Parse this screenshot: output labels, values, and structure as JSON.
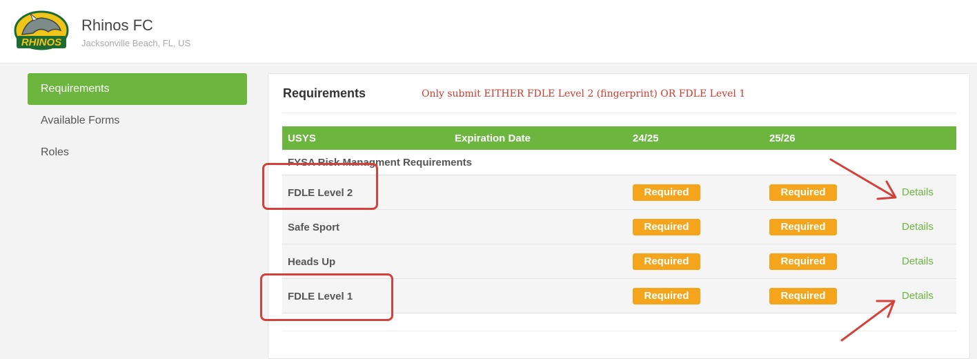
{
  "header": {
    "org_name": "Rhinos FC",
    "org_location": "Jacksonville Beach, FL, US",
    "logo_text": "RHINOS"
  },
  "sidebar": {
    "items": [
      {
        "label": "Requirements",
        "active": true
      },
      {
        "label": "Available Forms",
        "active": false
      },
      {
        "label": "Roles",
        "active": false
      }
    ]
  },
  "main": {
    "title": "Requirements",
    "note": "Only submit EITHER FDLE Level 2 (fingerprint) OR FDLE Level 1",
    "table": {
      "columns": [
        "USYS",
        "Expiration Date",
        "24/25",
        "25/26"
      ],
      "section": "FYSA Risk Managment Requirements",
      "rows": [
        {
          "name": "FDLE Level 2",
          "col_2425": "Required",
          "col_2526": "Required",
          "action": "Details"
        },
        {
          "name": "Safe Sport",
          "col_2425": "Required",
          "col_2526": "Required",
          "action": "Details"
        },
        {
          "name": "Heads Up",
          "col_2425": "Required",
          "col_2526": "Required",
          "action": "Details"
        },
        {
          "name": "FDLE Level 1",
          "col_2425": "Required",
          "col_2526": "Required",
          "action": "Details"
        }
      ]
    }
  },
  "colors": {
    "accent_green": "#6cb63f",
    "required_orange": "#f4a51c",
    "annotation_red": "#d2423a"
  }
}
